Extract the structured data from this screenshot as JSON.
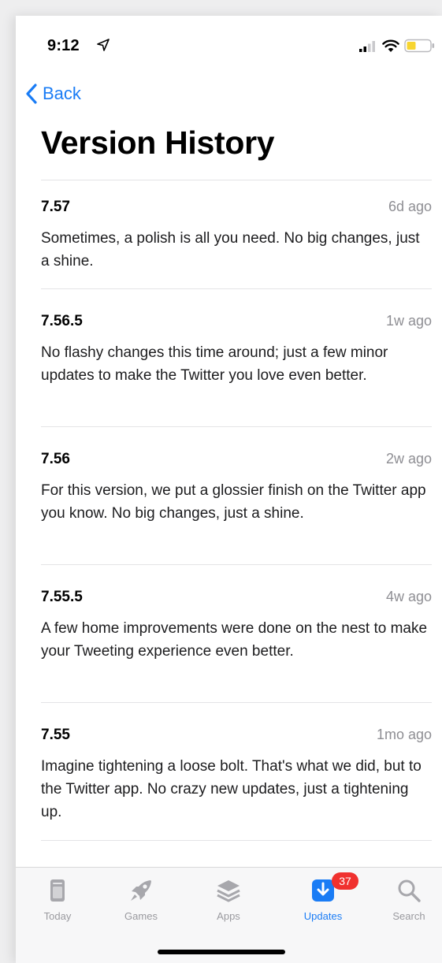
{
  "status_bar": {
    "time": "9:12"
  },
  "nav": {
    "back_label": "Back"
  },
  "page": {
    "title": "Version History"
  },
  "entries": [
    {
      "version": "7.57",
      "date": "6d ago",
      "notes": "Sometimes, a polish is all you need. No big changes, just a shine."
    },
    {
      "version": "7.56.5",
      "date": "1w ago",
      "notes": "No flashy changes this time around; just a few minor updates to make the Twitter you love even better."
    },
    {
      "version": "7.56",
      "date": "2w ago",
      "notes": "For this version, we put a glossier finish on the Twitter app you know. No big changes, just a shine."
    },
    {
      "version": "7.55.5",
      "date": "4w ago",
      "notes": "A few home improvements were done on the nest to make your Tweeting experience even better."
    },
    {
      "version": "7.55",
      "date": "1mo ago",
      "notes": "Imagine tightening a loose bolt. That's what we did, but to the Twitter app. No crazy new updates, just a tightening up."
    }
  ],
  "tab_bar": {
    "tabs": [
      {
        "label": "Today",
        "icon": "today-icon"
      },
      {
        "label": "Games",
        "icon": "rocket-icon"
      },
      {
        "label": "Apps",
        "icon": "layers-icon"
      },
      {
        "label": "Updates",
        "icon": "download-icon",
        "badge": "37",
        "active": true
      },
      {
        "label": "Search",
        "icon": "search-icon"
      }
    ]
  },
  "colors": {
    "accent": "#1a7cf5",
    "badge": "#f0312f",
    "secondary_text": "#8e8e93",
    "battery": "#f7d530"
  }
}
